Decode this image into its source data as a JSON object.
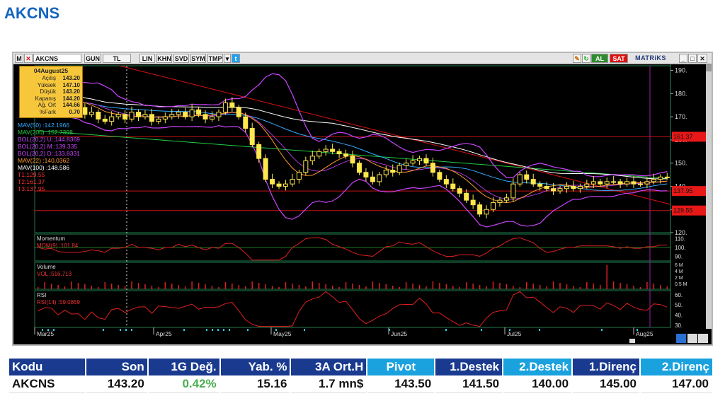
{
  "page_title": "AKCNS",
  "toolbar": {
    "symbol": "AKCNS",
    "buttons": [
      "GUN",
      "TL",
      "LIN",
      "KHN",
      "SVD",
      "SYM",
      "TMP"
    ],
    "al_label": "AL",
    "sat_label": "SAT",
    "logo": "MATRiKS",
    "colors": {
      "al": "#2e8b2e",
      "sat": "#dd1111"
    }
  },
  "infobox": {
    "date": "04August25",
    "rows": [
      {
        "label": "Açılış",
        "value": "143.20"
      },
      {
        "label": "Yüksek",
        "value": "147.10"
      },
      {
        "label": "Düşük",
        "value": "143.20"
      },
      {
        "label": "Kapanış",
        "value": "144.20"
      },
      {
        "label": "Ağ. Ort",
        "value": "144.66"
      },
      {
        "label": "%Fark",
        "value": "0.70"
      }
    ]
  },
  "legend": [
    {
      "name": "MAV(50)",
      "value": ":142.1966",
      "color": "#33aaff"
    },
    {
      "name": "MAV(200)",
      "value": ":152.7398",
      "color": "#22cc44"
    },
    {
      "name": "BOL(20,2) U:",
      "value": ":144.8369",
      "color": "#cc44ff"
    },
    {
      "name": "BOL(20,2) M:",
      "value": ":139.335",
      "color": "#cc44ff"
    },
    {
      "name": "BOL(20,2) D:",
      "value": ":133.8331",
      "color": "#cc44ff"
    },
    {
      "name": "MAV(22)",
      "value": ":140.0362",
      "color": "#ff9933"
    },
    {
      "name": "MAV(100)",
      "value": ":148.586",
      "color": "#ffffff"
    },
    {
      "name": "T1:129.55",
      "value": "",
      "color": "#ff3333"
    },
    {
      "name": "T2:161.37",
      "value": "",
      "color": "#ff3333"
    },
    {
      "name": "T3:137.95",
      "value": "",
      "color": "#ff3333"
    }
  ],
  "chart_data": {
    "type": "candlestick",
    "symbol": "AKCNS",
    "ylim": [
      120,
      192
    ],
    "y_ticks": [
      "190.",
      "180.",
      "170.",
      "160.",
      "150.",
      "140.",
      "130.",
      "120."
    ],
    "x_ticks": [
      "Mar25",
      "Apr25",
      "May25",
      "Jun25",
      "Jul25",
      "Aug25"
    ],
    "closes": [
      181,
      179,
      180,
      176,
      175,
      173,
      174,
      171,
      172,
      169,
      168,
      170,
      171,
      169,
      172,
      170,
      171,
      168,
      169,
      170,
      171,
      172,
      170,
      173,
      171,
      169,
      170,
      172,
      176,
      174,
      170,
      165,
      158,
      152,
      143,
      141,
      140,
      141,
      143,
      146,
      151,
      153,
      155,
      156,
      155,
      154,
      153,
      150,
      146,
      144,
      142,
      145,
      147,
      146,
      149,
      150,
      151,
      152,
      150,
      146,
      143,
      141,
      139,
      137,
      134,
      132,
      128,
      130,
      133,
      134,
      135,
      141,
      145,
      143,
      141,
      140,
      139,
      138,
      139,
      140,
      139,
      140,
      141,
      142,
      141,
      142,
      142,
      141,
      142,
      141,
      141,
      142,
      143,
      144,
      144
    ],
    "target_lines": [
      {
        "label": "161.37",
        "value": 161.37
      },
      {
        "label": "137.95",
        "value": 137.95
      },
      {
        "label": "129.55",
        "value": 129.55
      }
    ],
    "momentum": {
      "label": "Momentum",
      "series": "MOM(9)",
      "value": ":101.84",
      "ticks": [
        "110.",
        "100.",
        "90."
      ]
    },
    "volume": {
      "label": "Volume",
      "series": "VOL",
      "value": ":516,713",
      "ticks": [
        "6 M",
        "4 M",
        "2 M",
        "0.5 M"
      ]
    },
    "rsi": {
      "label": "RSI",
      "series": "RSI(14)",
      "value": ":59.0869",
      "ticks": [
        "60.",
        "50.",
        "40.",
        "30."
      ]
    }
  },
  "summary_table": {
    "headers": [
      "Kodu",
      "Son",
      "1G Değ.",
      "Yab. %",
      "3A Ort.H",
      "Pivot",
      "1.Destek",
      "2.Destek",
      "1.Direnç",
      "2.Direnç"
    ],
    "row": [
      "AKCNS",
      "143.20",
      "0.42%",
      "15.16",
      "1.7 mn$",
      "143.50",
      "141.50",
      "140.00",
      "145.00",
      "147.00"
    ],
    "change_color": "#4caf50"
  }
}
